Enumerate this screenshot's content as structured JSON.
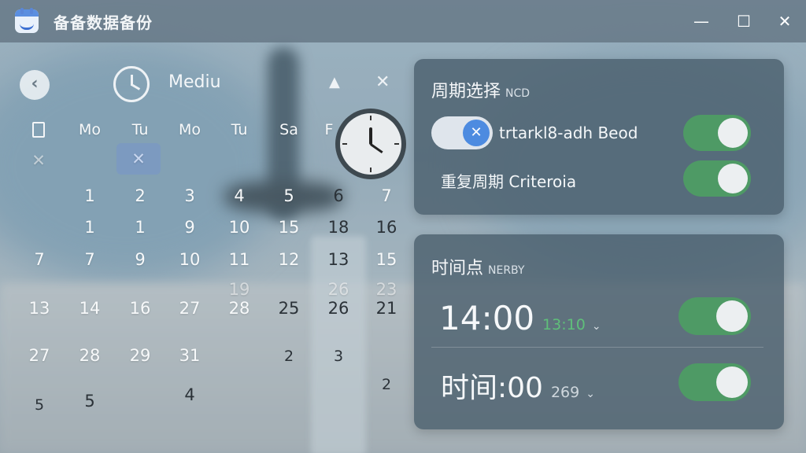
{
  "window": {
    "title": "备备数据备份",
    "minimize": "—",
    "maximize": "☐",
    "close": "✕"
  },
  "calendar": {
    "back_icon": "‹",
    "view_label": "Mediu",
    "up_icon": "▲",
    "close_icon": "✕",
    "weekdays": [
      "Mo",
      "Tu",
      "Mo",
      "Tu",
      "Sa",
      "F"
    ],
    "marks": [
      "✕",
      "✕"
    ],
    "rows": [
      [
        "1",
        "2",
        "3",
        "4",
        "5",
        "6",
        "7"
      ],
      [
        "1",
        "1",
        "9",
        "10",
        "15",
        "18",
        "16"
      ],
      [
        "7",
        "7",
        "9",
        "10",
        "11",
        "12",
        "13",
        "15"
      ],
      [
        "19",
        "26",
        "23"
      ],
      [
        "13",
        "14",
        "16",
        "27",
        "28",
        "25",
        "26",
        "21"
      ],
      [
        "27",
        "28",
        "29",
        "31",
        "2",
        "3"
      ],
      [
        "5",
        "5",
        "4",
        "2"
      ]
    ]
  },
  "repeat_panel": {
    "title": "周期选择",
    "subtitle": "NCD",
    "option1_label": "trtarkl8-adh Beod",
    "option2_label": "重复周期 Criteroia",
    "pill_icon": "✕"
  },
  "time_panel": {
    "title": "时间点",
    "subtitle": "NERBY",
    "time1_main": "14:00",
    "time1_secondary": "13:10",
    "time2_main": "时间:00",
    "time2_secondary": "269",
    "chevron": "⌄"
  },
  "colors": {
    "toggle_on": "#4e9a65",
    "accent_blue": "#4d8be0"
  }
}
